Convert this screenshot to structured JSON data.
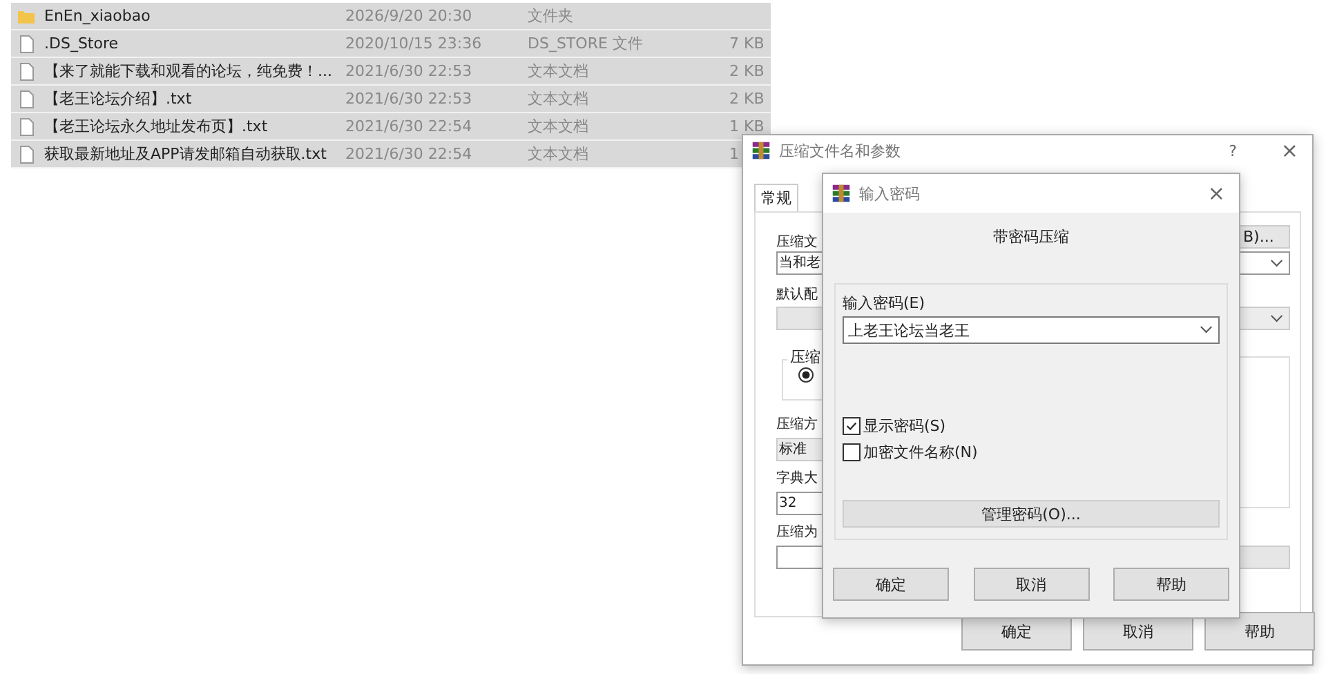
{
  "file_list": [
    {
      "kind": "folder",
      "name": "EnEn_xiaobao",
      "date": "2026/9/20 20:30",
      "type": "文件夹",
      "selected": true
    },
    {
      "kind": "file",
      "name": ".DS_Store",
      "date": "2020/10/15 23:36",
      "type": "DS_STORE 文件",
      "size": "7 KB",
      "selected": true
    },
    {
      "kind": "file",
      "name": "【来了就能下载和观看的论坛，纯免费！...",
      "date": "2021/6/30 22:53",
      "type": "文本文档",
      "size": "2 KB",
      "selected": true
    },
    {
      "kind": "file",
      "name": "【老王论坛介绍】.txt",
      "date": "2021/6/30 22:53",
      "type": "文本文档",
      "size": "2 KB",
      "selected": true
    },
    {
      "kind": "file",
      "name": "【老王论坛永久地址发布页】.txt",
      "date": "2021/6/30 22:54",
      "type": "文本文档",
      "size": "1 KB",
      "selected": true
    },
    {
      "kind": "file",
      "name": "获取最新地址及APP请发邮箱自动获取.txt",
      "date": "2021/6/30 22:54",
      "type": "文本文档",
      "size": "1",
      "selected": true
    }
  ],
  "archive_dialog": {
    "title": "压缩文件名和参数",
    "help": "?",
    "close": "×",
    "tab": "常规",
    "archive_name_label": "压缩文",
    "archive_name_value": "当和老",
    "browse_button": "B)...",
    "profile_label": "默认配",
    "group_label": "压缩",
    "format_option": {
      "selected": true
    },
    "method_label": "压缩方",
    "method_value": "标准",
    "dictionary_label": "字典大",
    "dictionary_value": "32",
    "split_label": "压缩为",
    "buttons": [
      "确定",
      "取消",
      "帮助"
    ]
  },
  "password_dialog": {
    "title": "输入密码",
    "close": "×",
    "heading": "带密码压缩",
    "password_label": "输入密码(E)",
    "password_value": "上老王论坛当老王",
    "options": [
      {
        "label": "显示密码(S)",
        "checked": true
      },
      {
        "label": "加密文件名称(N)",
        "checked": false
      }
    ],
    "organize_button": "管理密码(O)...",
    "buttons": [
      "确定",
      "取消",
      "帮助"
    ]
  }
}
